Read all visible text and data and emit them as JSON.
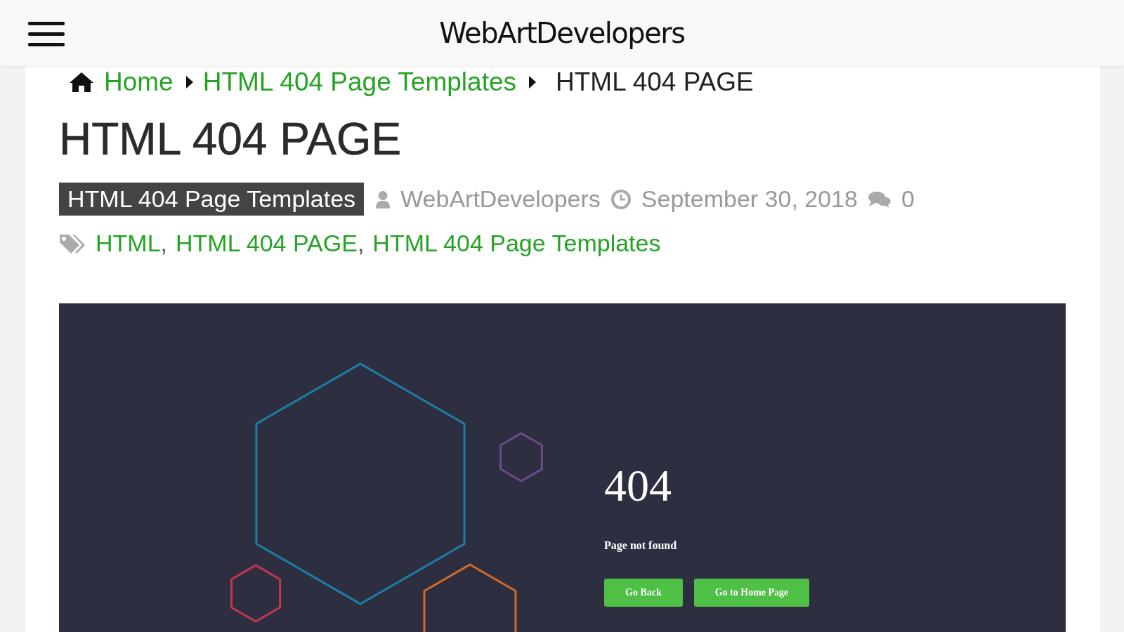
{
  "header": {
    "site_title": "WebArtDevelopers"
  },
  "breadcrumb": [
    {
      "label": "Home",
      "kind": "link"
    },
    {
      "label": "HTML 404 Page Templates",
      "kind": "link"
    },
    {
      "label": "HTML 404 PAGE",
      "kind": "current"
    }
  ],
  "article": {
    "title": "HTML 404 PAGE",
    "category": "HTML 404 Page Templates",
    "author": "WebArtDevelopers",
    "date": "September 30, 2018",
    "comments": "0",
    "tags": [
      {
        "label": "HTML",
        "separator": ","
      },
      {
        "label": "HTML 404 PAGE",
        "separator": ","
      },
      {
        "label": "HTML 404 Page Templates"
      }
    ]
  },
  "preview": {
    "heading": "404",
    "message": "Page not found",
    "buttons": [
      "Go Back",
      "Go to Home Page"
    ]
  }
}
